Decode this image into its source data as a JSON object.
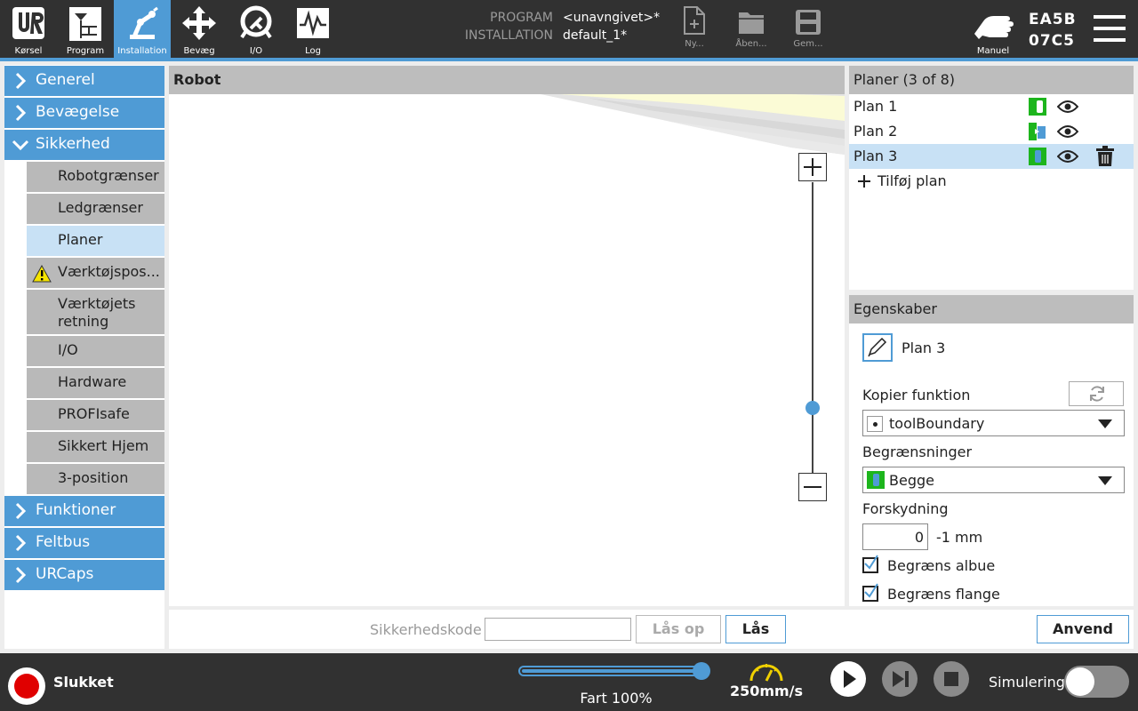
{
  "header": {
    "nav": [
      {
        "label": "Kørsel",
        "icon": "ur-logo-icon"
      },
      {
        "label": "Program",
        "icon": "program-icon"
      },
      {
        "label": "Installation",
        "icon": "robot-arm-icon"
      },
      {
        "label": "Bevæg",
        "icon": "move-icon"
      },
      {
        "label": "I/O",
        "icon": "io-icon"
      },
      {
        "label": "Log",
        "icon": "log-icon"
      }
    ],
    "program_key": "PROGRAM",
    "program_value": "<unavngivet>*",
    "installation_key": "INSTALLATION",
    "installation_value": "default_1*",
    "file_buttons": [
      {
        "label": "Ny...",
        "icon": "new-file-icon"
      },
      {
        "label": "Åben...",
        "icon": "open-folder-icon"
      },
      {
        "label": "Gem...",
        "icon": "save-icon"
      }
    ],
    "mode_label": "Manuel",
    "robot_id_line1": "EA5B",
    "robot_id_line2": "07C5"
  },
  "sidebar": {
    "categories_top": [
      {
        "label": "Generel",
        "expanded": false
      },
      {
        "label": "Bevægelse",
        "expanded": false
      },
      {
        "label": "Sikkerhed",
        "expanded": true
      }
    ],
    "safety_items": [
      {
        "label": "Robotgrænser"
      },
      {
        "label": "Ledgrænser"
      },
      {
        "label": "Planer",
        "selected": true
      },
      {
        "label": "Værktøjspos...",
        "warning": true
      },
      {
        "label_line1": "Værktøjets",
        "label_line2": "retning"
      },
      {
        "label": "I/O"
      },
      {
        "label": "Hardware"
      },
      {
        "label": "PROFIsafe"
      },
      {
        "label": "Sikkert Hjem"
      },
      {
        "label": "3-position"
      }
    ],
    "categories_bottom": [
      {
        "label": "Funktioner"
      },
      {
        "label": "Feltbus"
      },
      {
        "label": "URCaps"
      }
    ]
  },
  "robot_view": {
    "title": "Robot",
    "zoom_in": "+",
    "zoom_out": "−",
    "zoom_level": 0.5
  },
  "planes": {
    "title": "Planer (3 of 8)",
    "items": [
      {
        "label": "Plan 1"
      },
      {
        "label": "Plan 2"
      },
      {
        "label": "Plan 3",
        "selected": true
      }
    ],
    "add_label": "Tilføj plan"
  },
  "properties": {
    "title": "Egenskaber",
    "name_value": "Plan 3",
    "copy_label": "Kopier funktion",
    "copy_value": "toolBoundary",
    "limits_label": "Begrænsninger",
    "limits_value": "Begge",
    "offset_label": "Forskydning",
    "offset_value": "0",
    "offset_unit": "-1 mm",
    "restrict_elbow": "Begræns albue",
    "restrict_flange": "Begræns flange"
  },
  "lock_bar": {
    "code_label": "Sikkerhedskode",
    "unlock_label": "Lås op",
    "lock_label": "Lås",
    "apply_label": "Anvend"
  },
  "footer": {
    "power_status": "Slukket",
    "speed_label": "Fart 100%",
    "speed_fraction": 1.0,
    "tcp_speed": "250mm/s",
    "simulation_label": "Simulering"
  },
  "colors": {
    "accent": "#4f9bd5",
    "header_bg": "#313131",
    "selected_bg": "#c8e1f5",
    "green": "#1db51d"
  }
}
